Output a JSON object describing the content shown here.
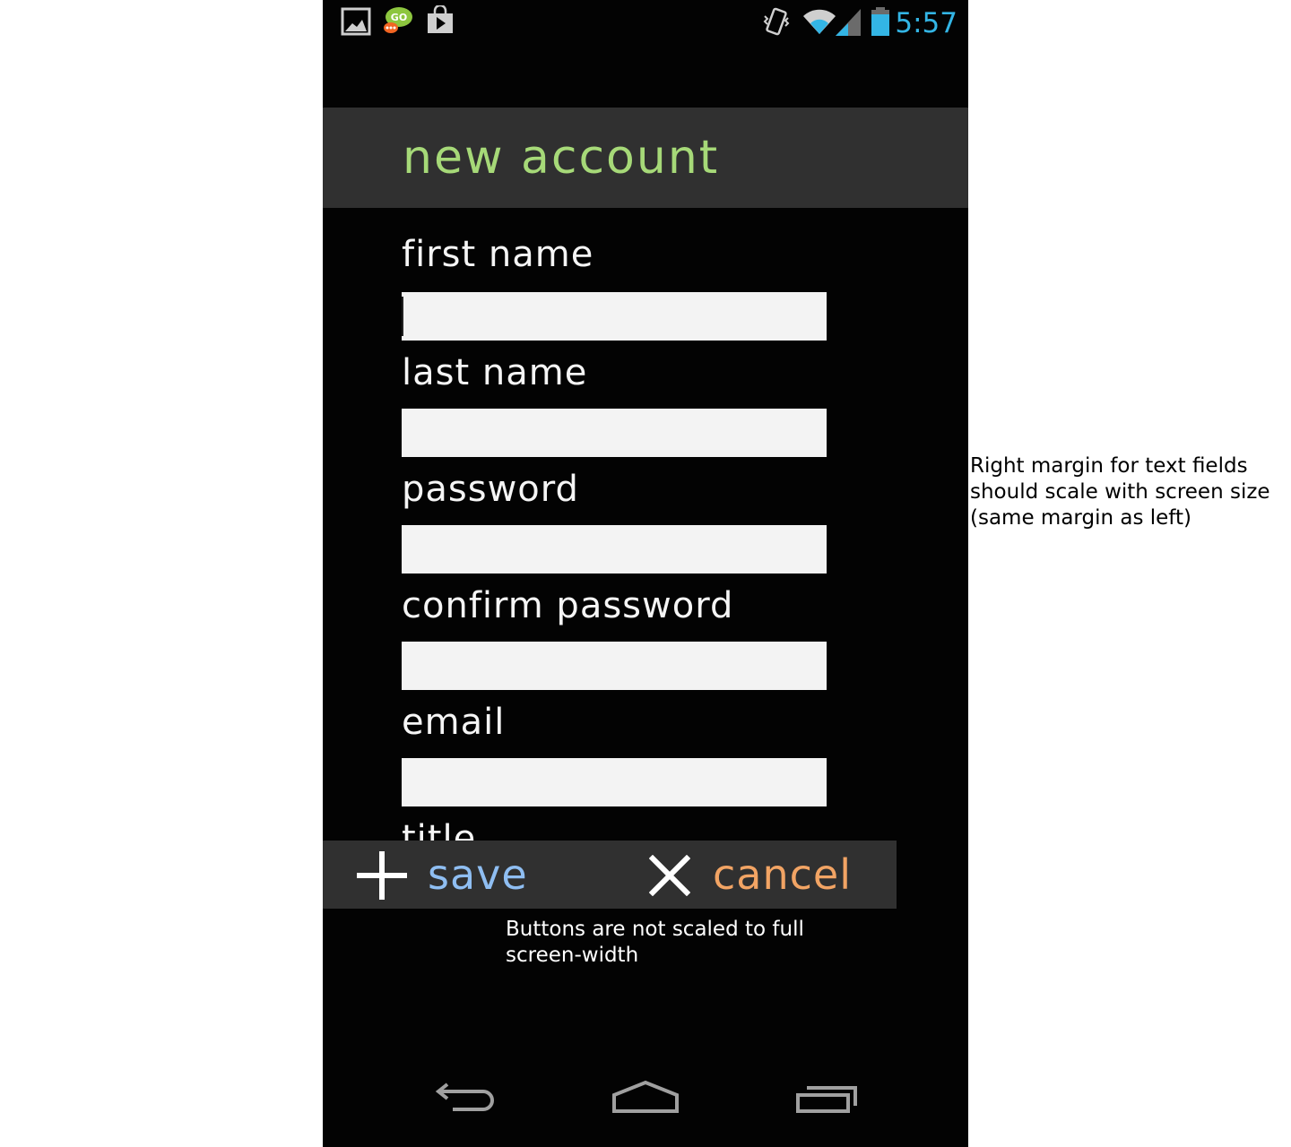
{
  "status_bar": {
    "time": "5:57",
    "left_icons": [
      "gallery-icon",
      "go-sms-icon",
      "play-store-icon"
    ],
    "right_icons": [
      "vibrate-icon",
      "wifi-icon",
      "signal-icon",
      "battery-icon"
    ],
    "clock_color": "#33b5e5"
  },
  "action_bar": {
    "title": "new account",
    "title_color": "#a6d978",
    "background": "#303030"
  },
  "form": {
    "fields": [
      {
        "label": "first name",
        "value": "",
        "type": "text"
      },
      {
        "label": "last name",
        "value": "",
        "type": "text"
      },
      {
        "label": "password",
        "value": "",
        "type": "password"
      },
      {
        "label": "confirm password",
        "value": "",
        "type": "password"
      },
      {
        "label": "email",
        "value": "",
        "type": "email"
      },
      {
        "label": "title",
        "value": "",
        "type": "text"
      }
    ]
  },
  "buttons": {
    "save": {
      "label": "save",
      "icon": "plus-icon",
      "color": "#8fbef2"
    },
    "cancel": {
      "label": "cancel",
      "icon": "close-icon",
      "color": "#f2a464"
    }
  },
  "nav_bar": {
    "icons": [
      "back-icon",
      "home-icon",
      "recent-apps-icon"
    ]
  },
  "annotations": {
    "right_margin_note": "Right margin for text fields\nshould scale with screen size\n(same margin as left)",
    "buttons_note": "Buttons are not scaled to full\nscreen-width"
  }
}
